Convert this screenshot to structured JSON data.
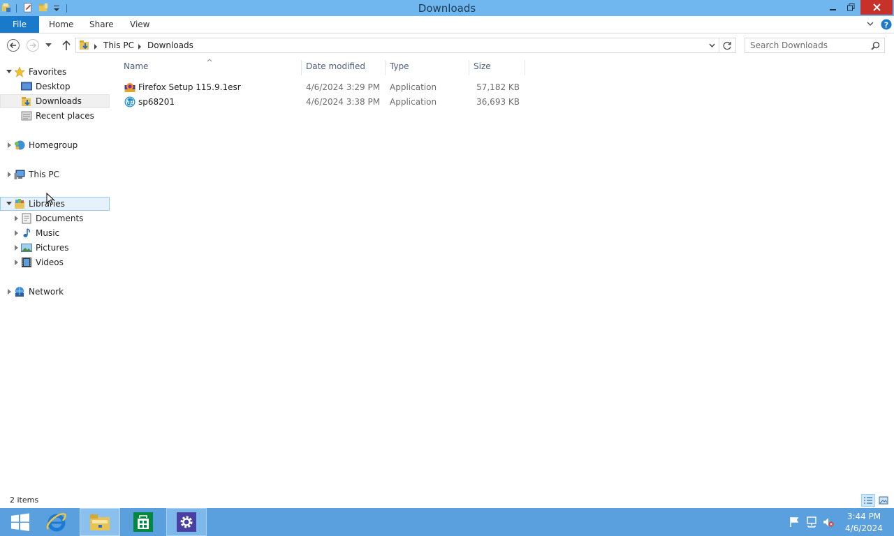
{
  "window": {
    "title": "Downloads"
  },
  "ribbon": {
    "tabs": [
      "File",
      "Home",
      "Share",
      "View"
    ]
  },
  "address": {
    "crumbs": [
      "This PC",
      "Downloads"
    ]
  },
  "search": {
    "placeholder": "Search Downloads"
  },
  "nav": {
    "favorites": {
      "label": "Favorites",
      "items": [
        "Desktop",
        "Downloads",
        "Recent places"
      ]
    },
    "homegroup": "Homegroup",
    "this_pc": "This PC",
    "libraries": {
      "label": "Libraries",
      "items": [
        "Documents",
        "Music",
        "Pictures",
        "Videos"
      ]
    },
    "network": "Network"
  },
  "columns": [
    "Name",
    "Date modified",
    "Type",
    "Size"
  ],
  "files": [
    {
      "name": "Firefox Setup 115.9.1esr",
      "date": "4/6/2024 3:29 PM",
      "type": "Application",
      "size": "57,182 KB",
      "icon": "firefox-installer-icon"
    },
    {
      "name": "sp68201",
      "date": "4/6/2024 3:38 PM",
      "type": "Application",
      "size": "36,693 KB",
      "icon": "hp-installer-icon"
    }
  ],
  "status": {
    "item_count": "2 items"
  },
  "taskbar": {
    "apps": [
      "start-button",
      "internet-explorer",
      "file-explorer",
      "store",
      "settings"
    ],
    "clock_time": "3:44 PM",
    "clock_date": "4/6/2024"
  },
  "colors": {
    "titlebar": "#6fb7ee",
    "file_tab": "#1979ca",
    "close": "#c7312a",
    "taskbar": "#5aa0df"
  }
}
